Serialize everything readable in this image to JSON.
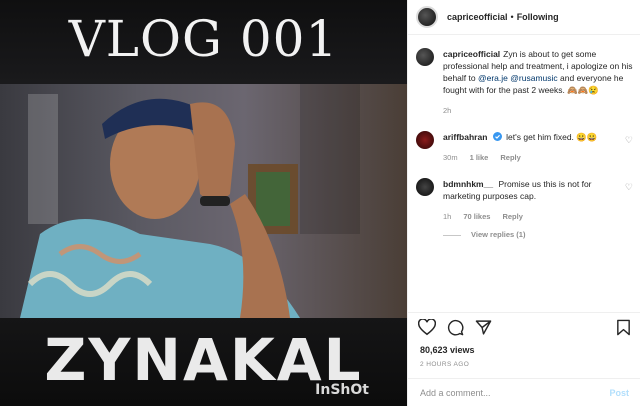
{
  "media": {
    "vlog_title": "VLOG 001",
    "name_overlay": "ZYNAKAL",
    "watermark": "InShOt"
  },
  "header": {
    "username": "capriceofficial",
    "separator": "•",
    "follow_status": "Following"
  },
  "caption": {
    "username": "capriceofficial",
    "text_before": "Zyn is about to get some professional help and treatment, i apologize on his behalf to",
    "mention1": "@era.je",
    "mention2": "@rusamusic",
    "text_after": "and everyone he fought with for the past 2 weeks. 🙈🙈😢",
    "time": "2h"
  },
  "comments": [
    {
      "username": "ariffbahran",
      "verified": true,
      "text": "let's get him fixed. 😀😀",
      "time": "30m",
      "likes": "1 like",
      "reply": "Reply"
    },
    {
      "username": "bdmnhkm__",
      "text": "Promise us this is not for marketing purposes cap.",
      "time": "1h",
      "likes": "70 likes",
      "reply": "Reply",
      "view_replies": "View replies (1)"
    }
  ],
  "stats": {
    "views": "80,623 views",
    "posted": "2 HOURS AGO"
  },
  "comment_box": {
    "placeholder": "Add a comment...",
    "post": "Post"
  },
  "colors": {
    "verified": "#3897f0",
    "link": "#00376b",
    "post_disabled": "#b2dffc"
  },
  "icons": [
    "heart-icon",
    "comment-icon",
    "share-icon",
    "bookmark-icon",
    "verified-badge-icon"
  ]
}
